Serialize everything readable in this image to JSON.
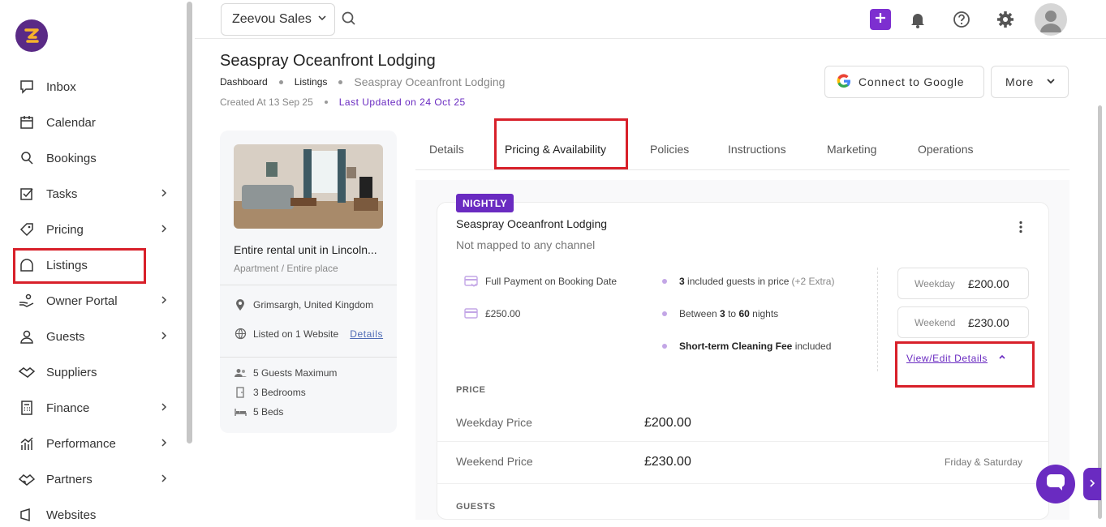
{
  "sidebar": {
    "items": [
      {
        "label": "Inbox",
        "icon": "chat-icon",
        "chevron": false
      },
      {
        "label": "Calendar",
        "icon": "calendar-icon",
        "chevron": false
      },
      {
        "label": "Bookings",
        "icon": "bookings-icon",
        "chevron": false
      },
      {
        "label": "Tasks",
        "icon": "tasks-icon",
        "chevron": true
      },
      {
        "label": "Pricing",
        "icon": "tag-icon",
        "chevron": true
      },
      {
        "label": "Listings",
        "icon": "house-icon",
        "chevron": false
      },
      {
        "label": "Owner Portal",
        "icon": "owner-icon",
        "chevron": true
      },
      {
        "label": "Guests",
        "icon": "user-icon",
        "chevron": true
      },
      {
        "label": "Suppliers",
        "icon": "handshake-icon",
        "chevron": false
      },
      {
        "label": "Finance",
        "icon": "calculator-icon",
        "chevron": true
      },
      {
        "label": "Performance",
        "icon": "chart-icon",
        "chevron": true
      },
      {
        "label": "Partners",
        "icon": "partners-icon",
        "chevron": true
      },
      {
        "label": "Websites",
        "icon": "website-icon",
        "chevron": false
      }
    ]
  },
  "topbar": {
    "workspace": "Zeevou Sales"
  },
  "page": {
    "title": "Seaspray Oceanfront Lodging",
    "breadcrumb": [
      "Dashboard",
      "Listings",
      "Seaspray Oceanfront Lodging"
    ],
    "created": "Created At 13 Sep 25",
    "updated": "Last Updated on 24 Oct 25",
    "connect_google": "Connect to Google",
    "more": "More"
  },
  "property_card": {
    "title": "Entire rental unit in Lincoln...",
    "subtitle": "Apartment / Entire place",
    "location": "Grimsargh, United Kingdom",
    "listed": "Listed on 1 Website",
    "details_link": "Details",
    "guests": "5 Guests Maximum",
    "bedrooms": "3 Bedrooms",
    "beds": "5 Beds"
  },
  "tabs": [
    "Details",
    "Pricing & Availability",
    "Policies",
    "Instructions",
    "Marketing",
    "Operations"
  ],
  "rate_plan": {
    "badge": "NIGHTLY",
    "title": "Seaspray Oceanfront Lodging",
    "subtitle": "Not mapped to any channel",
    "payment": "Full Payment on Booking Date",
    "deposit": "£250.00",
    "guests_bold": "3",
    "guests_text": "included guests in price",
    "guests_extra": "(+2 Extra)",
    "nights_pre": "Between",
    "nights_min": "3",
    "nights_mid": "to",
    "nights_max": "60",
    "nights_post": "nights",
    "cleaning_bold": "Short-term Cleaning Fee",
    "cleaning_text": "included",
    "weekday_label": "Weekday",
    "weekday_value": "£200.00",
    "weekend_label": "Weekend",
    "weekend_value": "£230.00",
    "view_edit": "View/Edit Details"
  },
  "price_section": {
    "heading": "PRICE",
    "weekday_label": "Weekday Price",
    "weekday_value": "£200.00",
    "weekend_label": "Weekend Price",
    "weekend_value": "£230.00",
    "weekend_note": "Friday & Saturday",
    "guests_heading": "GUESTS"
  },
  "colors": {
    "brand": "#6a2bc1",
    "highlight": "#d8202a"
  }
}
